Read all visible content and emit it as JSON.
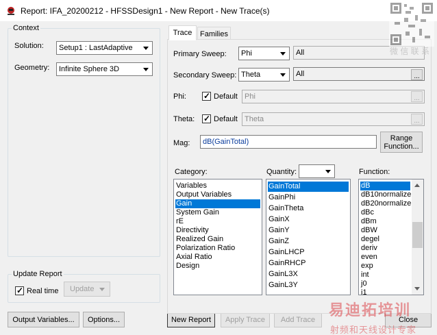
{
  "window": {
    "title": "Report: IFA_20200212 - HFSSDesign1 - New Report - New Trace(s)"
  },
  "context": {
    "legend": "Context",
    "solution_label": "Solution:",
    "solution_value": "Setup1 : LastAdaptive",
    "geometry_label": "Geometry:",
    "geometry_value": "Infinite Sphere 3D"
  },
  "update_report": {
    "legend": "Update Report",
    "realtime_label": "Real time",
    "realtime_checked": true,
    "update_button": "Update"
  },
  "bottom_buttons": {
    "output_variables": "Output Variables...",
    "options": "Options...",
    "new_report": "New Report",
    "apply_trace": "Apply Trace",
    "add_trace": "Add Trace",
    "close": "Close"
  },
  "tabs": [
    {
      "label": "Trace",
      "active": true
    },
    {
      "label": "Families",
      "active": false
    }
  ],
  "trace": {
    "primary_sweep_label": "Primary Sweep:",
    "primary_sweep_value": "Phi",
    "primary_sweep_range": "All",
    "secondary_sweep_label": "Secondary Sweep:",
    "secondary_sweep_value": "Theta",
    "secondary_sweep_range": "All",
    "phi_label": "Phi:",
    "phi_default_label": "Default",
    "phi_value": "Phi",
    "theta_label": "Theta:",
    "theta_default_label": "Default",
    "theta_value": "Theta",
    "mag_label": "Mag:",
    "mag_value": "dB(GainTotal)",
    "range_function_button": "Range\nFunction...",
    "ellipsis": "...",
    "category_label": "Category:",
    "quantity_label": "Quantity:",
    "quantity_filter": "",
    "function_label": "Function:",
    "categories": [
      "Variables",
      "Output Variables",
      "Gain",
      "System Gain",
      "rE",
      "Directivity",
      "Realized Gain",
      "Polarization Ratio",
      "Axial Ratio",
      "Design"
    ],
    "category_selected": "Gain",
    "quantities": [
      "GainTotal",
      "GainPhi",
      "GainTheta",
      "GainX",
      "GainY",
      "GainZ",
      "GainLHCP",
      "GainRHCP",
      "GainL3X",
      "GainL3Y"
    ],
    "quantity_selected": "GainTotal",
    "functions": [
      "dB",
      "dB10normalize",
      "dB20normalize",
      "dBc",
      "dBm",
      "dBW",
      "degel",
      "deriv",
      "even",
      "exp",
      "int",
      "j0",
      "j1"
    ],
    "function_selected": "dB"
  },
  "watermarks": {
    "qr_caption": "微 信 联 系",
    "brand_title": "易迪拓培训",
    "brand_subtitle": "射频和天线设计专家"
  },
  "colors": {
    "selection": "#0078d7",
    "window_bg": "#f0f0f0",
    "brand_red": "#d9262c"
  }
}
